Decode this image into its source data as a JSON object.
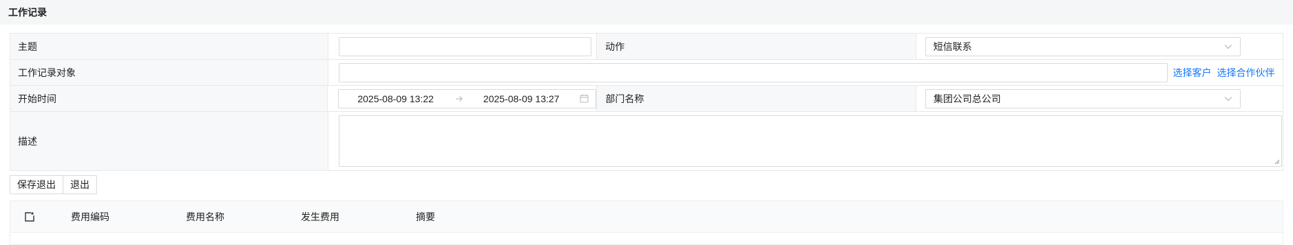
{
  "header": {
    "title": "工作记录"
  },
  "form": {
    "subject_label": "主题",
    "subject_value": "",
    "action_label": "动作",
    "action_value": "短信联系",
    "target_label": "工作记录对象",
    "target_value": "",
    "select_customer": "选择客户",
    "select_partner": "选择合作伙伴",
    "start_time_label": "开始时间",
    "start_time_from": "2025-08-09 13:22",
    "start_time_to": "2025-08-09 13:27",
    "department_label": "部门名称",
    "department_value": "集团公司总公司",
    "description_label": "描述",
    "description_value": ""
  },
  "buttons": {
    "save_exit": "保存退出",
    "exit": "退出"
  },
  "fee_table": {
    "columns": [
      "费用编码",
      "费用名称",
      "发生费用",
      "摘要"
    ],
    "rows": []
  },
  "icons": {
    "chevron": "chevron-down-icon",
    "arrow": "arrow-right-icon",
    "calendar": "calendar-icon",
    "add_row": "add-row-icon"
  },
  "colors": {
    "link": "#1677ff",
    "label_bg": "#f7f8fa",
    "border": "#d9d9d9"
  }
}
